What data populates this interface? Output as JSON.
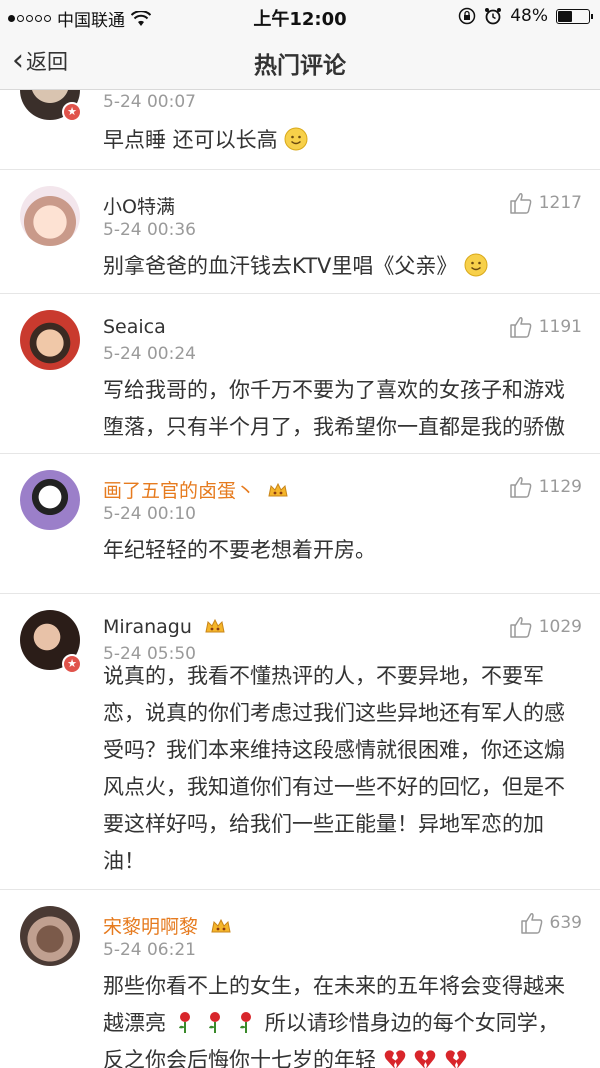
{
  "status_bar": {
    "carrier": "中国联通",
    "time": "上午12:00",
    "battery": "48%"
  },
  "nav": {
    "back_label": "返回",
    "title": "热门评论"
  },
  "comments": [
    {
      "time": "5-24 00:07",
      "body": "早点睡 还可以长高"
    },
    {
      "name": "小O特满",
      "time": "5-24 00:36",
      "likes": "1217",
      "body": "别拿爸爸的血汗钱去KTV里唱《父亲》"
    },
    {
      "name": "Seaica",
      "time": "5-24 00:24",
      "likes": "1191",
      "body_line1": "写给我哥的，你千万不要为了喜欢的女孩子和游戏",
      "body_line2": "堕落，只有半个月了，我希望你一直都是我的骄傲"
    },
    {
      "name": "画了五官的卤蛋丶",
      "time": "5-24 00:10",
      "likes": "1129",
      "body": "年纪轻轻的不要老想着开房。"
    },
    {
      "name": "Miranagu",
      "time": "5-24 05:50",
      "likes": "1029",
      "body_lines": [
        "说真的，我看不懂热评的人，不要异地，不要军",
        "恋，说真的你们考虑过我们这些异地还有军人的感",
        "受吗？我们本来维持这段感情就很困难，你还这煽",
        "风点火，我知道你们有过一些不好的回忆，但是不",
        "要这样好吗，给我们一些正能量！异地军恋的加",
        "油！"
      ]
    },
    {
      "name": "宋黎明啊黎",
      "time": "5-24 06:21",
      "likes": "639",
      "line1": "那些你看不上的女生，在未来的五年将会变得越来",
      "line2_pre": "越漂亮",
      "line2_post": "所以请珍惜身边的每个女同学，",
      "line3": "反之你会后悔你十七岁的年轻"
    }
  ],
  "icons": {
    "like": "thumbs-up-icon",
    "smile": "smile-emoji-icon",
    "rose": "rose-emoji-icon",
    "broken_heart": "broken-heart-emoji-icon",
    "crown": "crown-badge-icon",
    "verified": "verified-badge-icon"
  },
  "colors": {
    "gold_name": "#e67b1f",
    "text": "#333333",
    "meta": "#9a9a9a"
  }
}
